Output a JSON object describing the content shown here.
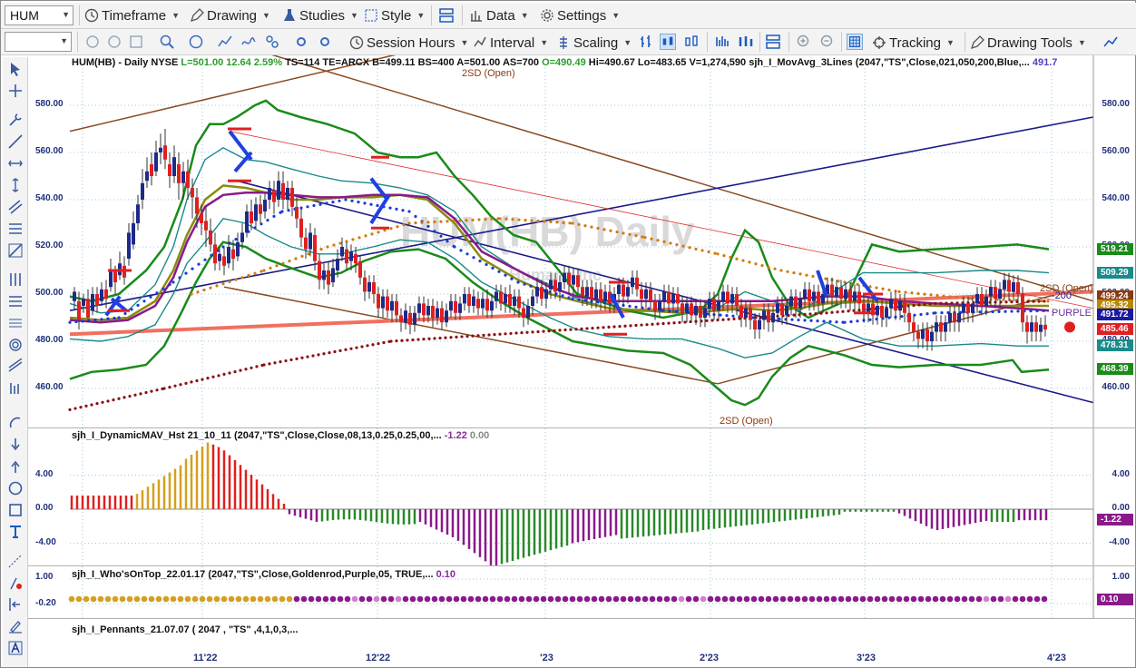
{
  "toolbar1": {
    "symbol": "HUM",
    "items": [
      {
        "label": "Timeframe"
      },
      {
        "label": "Drawing"
      },
      {
        "label": "Studies"
      },
      {
        "label": "Style"
      },
      {
        "label": "Data"
      },
      {
        "label": "Settings"
      }
    ]
  },
  "toolbar2": {
    "items": [
      {
        "label": "Session Hours"
      },
      {
        "label": "Interval"
      },
      {
        "label": "Scaling"
      },
      {
        "label": "Tracking"
      },
      {
        "label": "Drawing Tools"
      }
    ]
  },
  "main_pane": {
    "header_prefix": "HUM(HB) - Daily  NYSE",
    "header_last": "L=501.00",
    "header_chg": "12.64",
    "header_pct": "2.59%",
    "header_rest": "TS=114  TE=ARCX  B=499.11  BS=400  A=501.00  AS=700",
    "header_open": "O=490.49",
    "header_hilo": "Hi=490.67  Lo=483.65  V=1,274,590",
    "header_study": "sjh_I_MovAvg_3Lines (2047,\"TS\",Close,021,050,200,Blue,...",
    "header_study_val": "491.7",
    "watermark": "HUM(HB) Daily",
    "watermark2": "Humana Inc",
    "annotations": [
      "2SD (Open)",
      "2SD (Open)",
      "2SD (Open)",
      "-200",
      "PURPLE"
    ],
    "y_ticks": [
      "580.00",
      "560.00",
      "540.00",
      "520.00",
      "500.00",
      "480.00",
      "460.00"
    ],
    "badges": [
      {
        "text": "519.21",
        "color": "#1a8a1a"
      },
      {
        "text": "509.29",
        "color": "#1a8a8a"
      },
      {
        "text": "499.24",
        "color": "#8a3a10"
      },
      {
        "text": "495.32",
        "color": "#b88a00"
      },
      {
        "text": "491.72",
        "color": "#1a1aa0"
      },
      {
        "text": "485.46",
        "color": "#e02020"
      },
      {
        "text": "478.31",
        "color": "#1a8a8a"
      },
      {
        "text": "468.39",
        "color": "#1a8a1a"
      }
    ]
  },
  "pane2": {
    "header": "sjh_I_DynamicMAV_Hst 21_10_11 (2047,\"TS\",Close,Close,08,13,0.25,0.25,00,...",
    "val1": "-1.22",
    "val2": "0.00",
    "y_ticks": [
      "4.00",
      "0.00",
      "-4.00"
    ],
    "badge": "-1.22"
  },
  "pane3": {
    "header": "sjh_I_Who'sOnTop_22.01.17 (2047,\"TS\",Close,Goldenrod,Purple,05, TRUE,...",
    "val": "0.10",
    "y_ticks": [
      "1.00",
      "-0.20"
    ],
    "badge": "0.10"
  },
  "pane4": {
    "header": "sjh_I_Pennants_21.07.07 ( 2047 , \"TS\" ,4,1,0,3,..."
  },
  "x_ticks": [
    "11'22",
    "12'22",
    "'23",
    "2'23",
    "3'23",
    "4'23"
  ],
  "colors": {
    "up": "#1e2a8a",
    "down": "#e02020",
    "upper_band": "#1a8a1a",
    "mid_band": "#1a8a8a",
    "ma_olive": "#8a8a10",
    "ma_purple": "#8a1a8a",
    "trend_navy": "#1a1a8a",
    "channel_brown": "#8a4a20",
    "salmon": "#f07060",
    "hist_red": "#e02020",
    "hist_gold": "#d4a020",
    "hist_purple": "#8a1a8a",
    "hist_green": "#2a8a2a"
  }
}
